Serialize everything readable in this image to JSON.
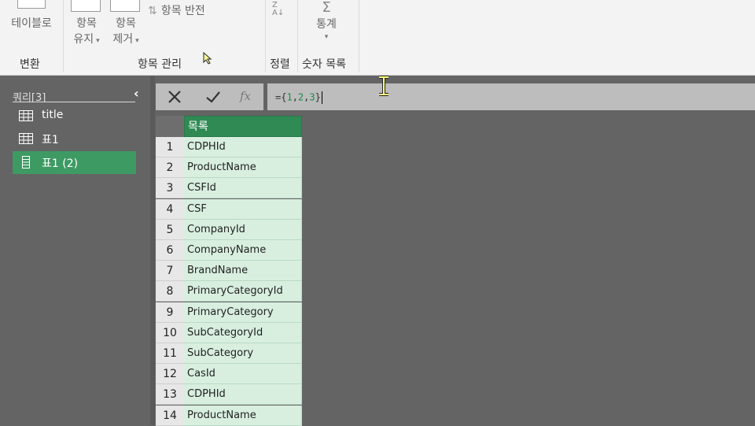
{
  "ribbon": {
    "btn_table": "테이블로",
    "btn_keep_1": "항목",
    "btn_keep_2": "유지",
    "btn_remove_1": "항목",
    "btn_remove_2": "제거",
    "btn_reverse": "항목 반전",
    "btn_stats": "통계",
    "group_convert": "변환",
    "group_manage": "항목 관리",
    "group_sort": "정렬",
    "group_numlist": "숫자 목록"
  },
  "panel": {
    "title": "쿼리[3]",
    "queries": [
      {
        "label": "title",
        "icon": "table-icon"
      },
      {
        "label": "표1",
        "icon": "table-icon"
      },
      {
        "label": "표1 (2)",
        "icon": "list-icon",
        "selected": true
      }
    ]
  },
  "formula": {
    "prefix": "={",
    "v1": "1",
    "c1": ",",
    "v2": "2",
    "c2": ",",
    "v3": "3",
    "suffix": "}"
  },
  "table": {
    "header": "목록",
    "rows": [
      {
        "n": "1",
        "v": "CDPHId"
      },
      {
        "n": "2",
        "v": "ProductName"
      },
      {
        "n": "3",
        "v": "CSFId"
      },
      {
        "n": "4",
        "v": "CSF"
      },
      {
        "n": "5",
        "v": "CompanyId"
      },
      {
        "n": "6",
        "v": "CompanyName"
      },
      {
        "n": "7",
        "v": "BrandName"
      },
      {
        "n": "8",
        "v": "PrimaryCategoryId"
      },
      {
        "n": "9",
        "v": "PrimaryCategory"
      },
      {
        "n": "10",
        "v": "SubCategoryId"
      },
      {
        "n": "11",
        "v": "SubCategory"
      },
      {
        "n": "12",
        "v": "CasId"
      },
      {
        "n": "13",
        "v": "CDPHId"
      },
      {
        "n": "14",
        "v": "ProductName"
      }
    ]
  },
  "colors": {
    "accent": "#3e9a63",
    "header": "#2f8a54",
    "cell": "#d8efe0"
  }
}
